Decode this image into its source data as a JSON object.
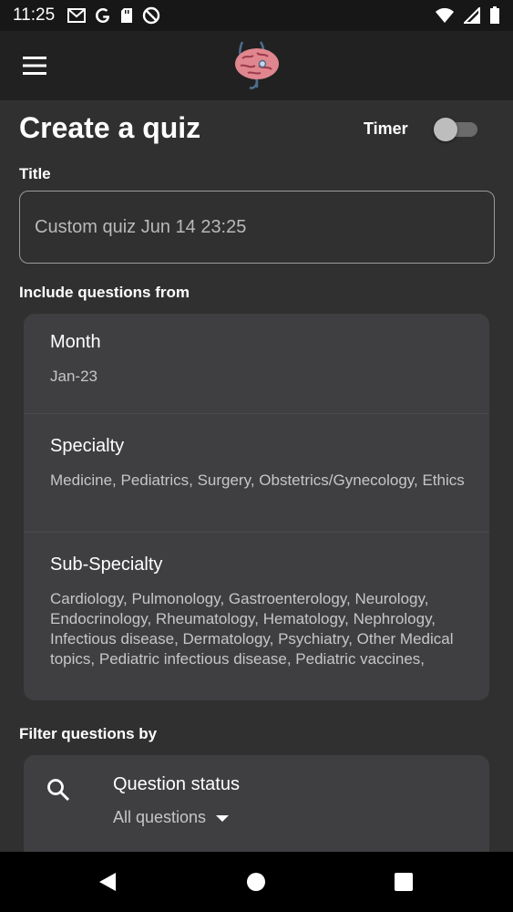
{
  "status_bar": {
    "time": "11:25",
    "left_icons": [
      "gmail-icon",
      "google-icon",
      "sd-card-icon",
      "do-not-disturb-icon"
    ],
    "right_icons": [
      "wifi-icon",
      "signal-icon",
      "battery-icon"
    ]
  },
  "app_bar": {
    "menu_icon": "hamburger-menu-icon",
    "logo_icon": "brain-stethoscope-logo"
  },
  "page": {
    "title": "Create a quiz",
    "timer_label": "Timer",
    "timer_on": false
  },
  "title_field": {
    "label": "Title",
    "value": "Custom quiz Jun 14 23:25"
  },
  "include": {
    "label": "Include questions from",
    "items": [
      {
        "title": "Month",
        "value": "Jan-23"
      },
      {
        "title": "Specialty",
        "value": "Medicine, Pediatrics, Surgery, Obstetrics/Gynecology, Ethics"
      },
      {
        "title": "Sub-Specialty",
        "value": "Cardiology, Pulmonology, Gastroenterology, Neurology, Endocrinology, Rheumatology, Hematology, Nephrology, Infectious disease, Dermatology, Psychiatry, Other Medical topics, Pediatric infectious disease, Pediatric vaccines,"
      }
    ]
  },
  "filter": {
    "label": "Filter questions by",
    "status_title": "Question status",
    "status_value": "All questions"
  },
  "colors": {
    "background": "#303030",
    "app_bar": "#212121",
    "card": "#3f3e41",
    "toggle_off_track": "#6b6b6b",
    "toggle_off_thumb": "#bdbdbd"
  }
}
